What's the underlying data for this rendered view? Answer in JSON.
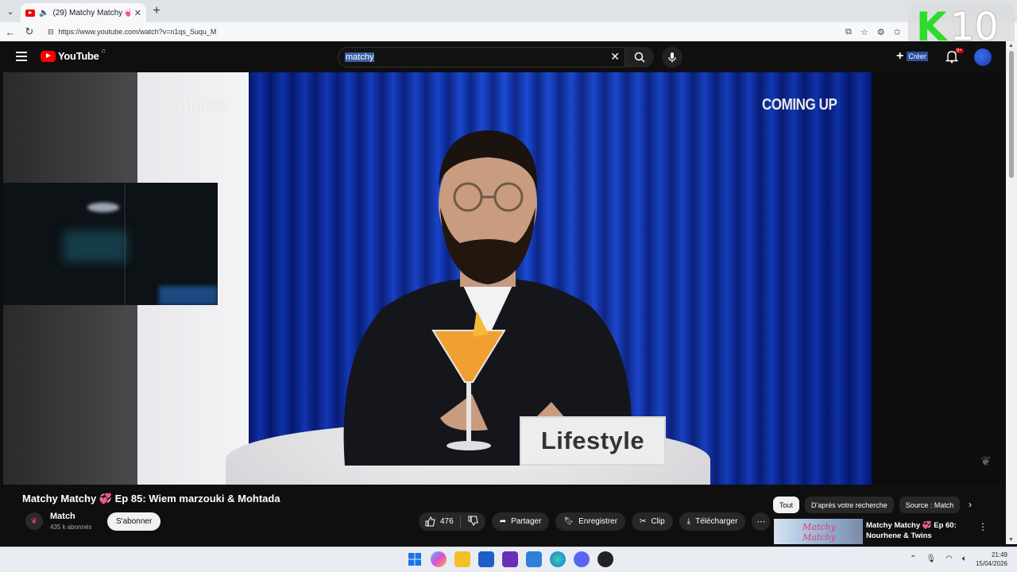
{
  "browser": {
    "tab_title": "(29) Matchy Matchy 💞 Ep 85",
    "url": "https://www.youtube.com/watch?v=n1qs_Suqu_M",
    "k10_letter": "K",
    "k10_number": "10"
  },
  "header": {
    "logo_text": "YouTube",
    "region": "IT",
    "search_query": "matchy",
    "create_label": "Créer",
    "notifications_badge": "9+"
  },
  "video": {
    "overlay_logo": "match",
    "coming_up": "COMING UP",
    "sign_text": "Lifestyle",
    "title_prefix": "Matchy Matchy",
    "title_heart": "💞",
    "title_suffix": "Ep 85: Wiem marzouki & Mohtada",
    "accent_color": "#e23b6d"
  },
  "channel": {
    "name": "Match",
    "subscribers": "435 k abonnés",
    "subscribe_label": "S'abonner"
  },
  "actions": {
    "likes": "476",
    "share": "Partager",
    "save": "Enregistrer",
    "clip": "Clip",
    "download": "Télécharger"
  },
  "chips": [
    "Tout",
    "D'après votre recherche",
    "Source : Match"
  ],
  "recommendation": {
    "thumb_text": "Matchy Matchy",
    "title_prefix": "Matchy Matchy",
    "title_heart": "💞",
    "title_suffix": "Ep 60: Nourhene & Twins"
  },
  "taskbar": {
    "time": "21:49",
    "date": "15/04/2026"
  }
}
